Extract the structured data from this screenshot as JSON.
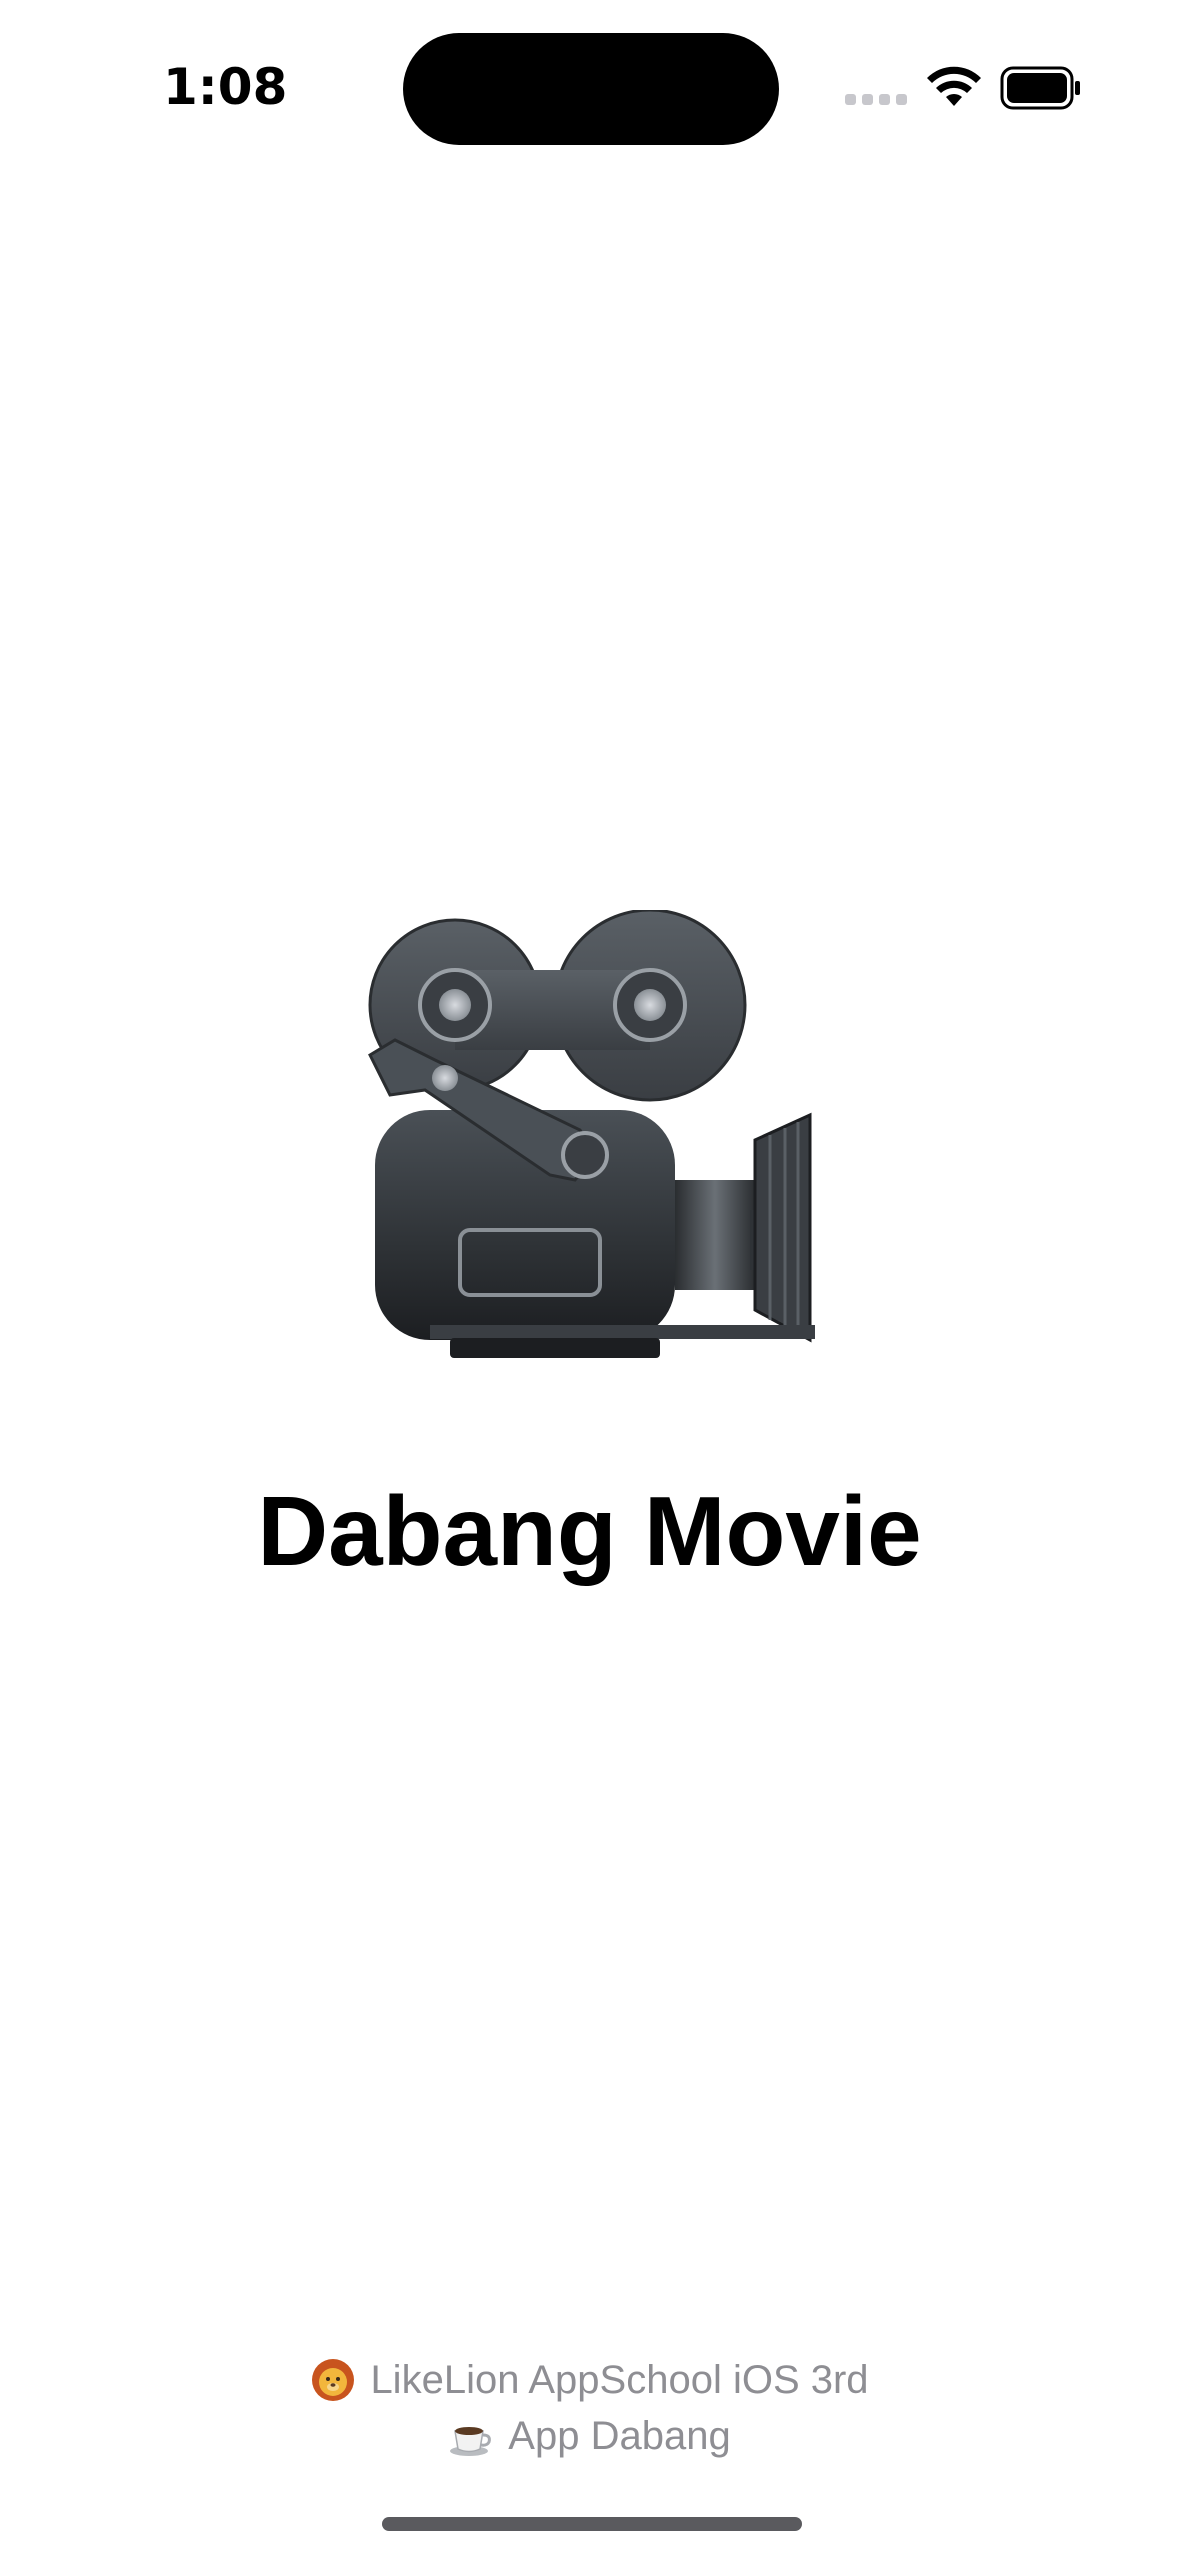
{
  "status_bar": {
    "time": "1:08",
    "icons": [
      "cellular-signal-icon",
      "wifi-icon",
      "battery-icon"
    ]
  },
  "main": {
    "hero_icon": "movie-camera-icon",
    "title": "Dabang Movie"
  },
  "footer": {
    "line1_icon": "lion-face-icon",
    "line1_text": "LikeLion AppSchool iOS 3rd",
    "line2_icon": "hot-beverage-icon",
    "line2_text": "App Dabang"
  },
  "colors": {
    "background": "#ffffff",
    "title": "#000000",
    "footer_text": "#8e8e93",
    "home_indicator": "#5a5a5e"
  }
}
